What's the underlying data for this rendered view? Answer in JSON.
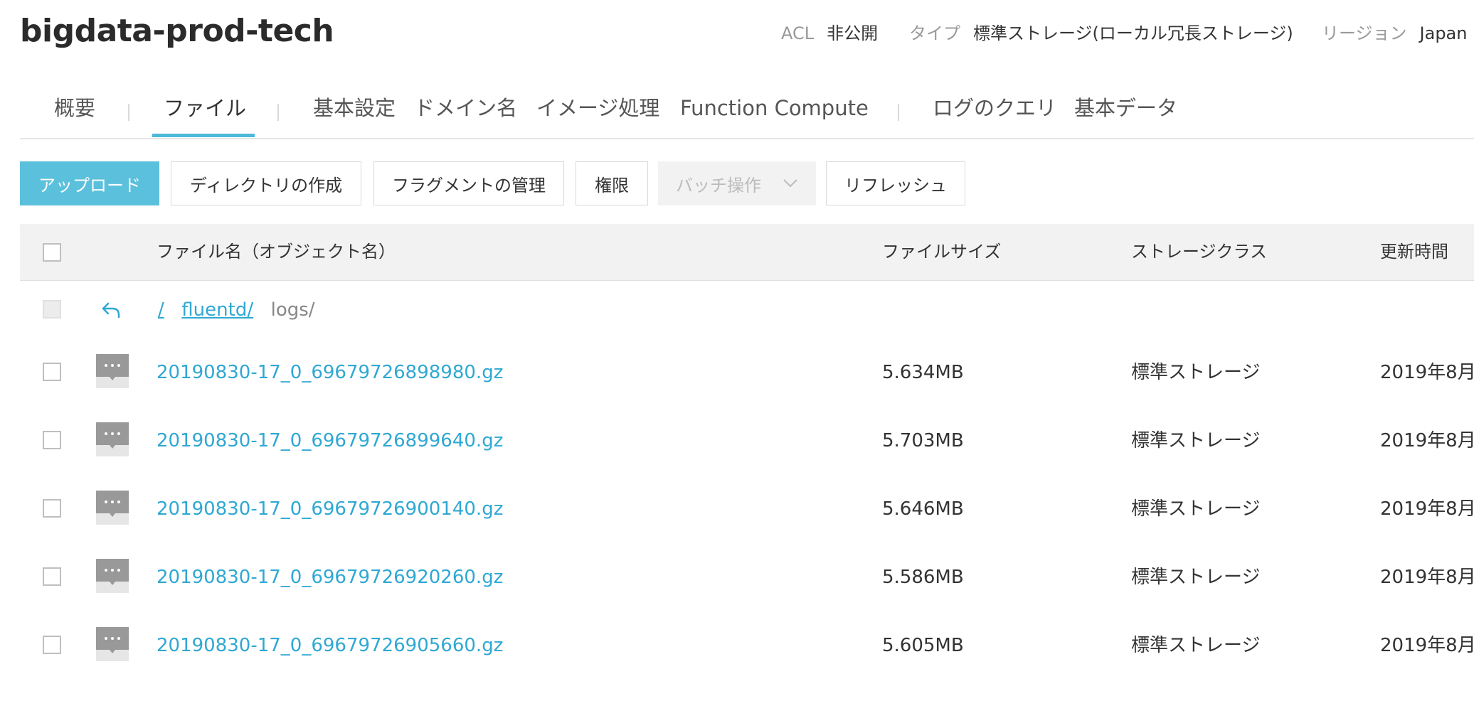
{
  "header": {
    "bucket_name": "bigdata-prod-tech",
    "acl_label": "ACL",
    "acl_value": "非公開",
    "type_label": "タイプ",
    "type_value": "標準ストレージ(ローカル冗長ストレージ)",
    "region_label": "リージョン",
    "region_value": "Japan"
  },
  "tabs": {
    "overview": "概要",
    "files": "ファイル",
    "basic_settings": "基本設定",
    "domain": "ドメイン名",
    "image_processing": "イメージ処理",
    "function_compute": "Function Compute",
    "log_query": "ログのクエリ",
    "basic_data": "基本データ",
    "active": "files"
  },
  "toolbar": {
    "upload": "アップロード",
    "create_dir": "ディレクトリの作成",
    "fragment_mgmt": "フラグメントの管理",
    "permissions": "権限",
    "batch_ops": "バッチ操作",
    "refresh": "リフレッシュ"
  },
  "table": {
    "columns": {
      "name": "ファイル名（オブジェクト名）",
      "size": "ファイルサイズ",
      "storage_class": "ストレージクラス",
      "modified": "更新時間"
    },
    "path": {
      "root": "/",
      "parent": "fluentd/",
      "current": "logs/"
    },
    "rows": [
      {
        "name": "20190830-17_0_69679726898980.gz",
        "size": "5.634MB",
        "storage_class": "標準ストレージ",
        "modified": "2019年8月"
      },
      {
        "name": "20190830-17_0_69679726899640.gz",
        "size": "5.703MB",
        "storage_class": "標準ストレージ",
        "modified": "2019年8月"
      },
      {
        "name": "20190830-17_0_69679726900140.gz",
        "size": "5.646MB",
        "storage_class": "標準ストレージ",
        "modified": "2019年8月"
      },
      {
        "name": "20190830-17_0_69679726920260.gz",
        "size": "5.586MB",
        "storage_class": "標準ストレージ",
        "modified": "2019年8月"
      },
      {
        "name": "20190830-17_0_69679726905660.gz",
        "size": "5.605MB",
        "storage_class": "標準ストレージ",
        "modified": "2019年8月"
      }
    ]
  },
  "colors": {
    "accent": "#5bc0dc",
    "link": "#2fa8d3",
    "header_bg": "#f2f2f2"
  }
}
